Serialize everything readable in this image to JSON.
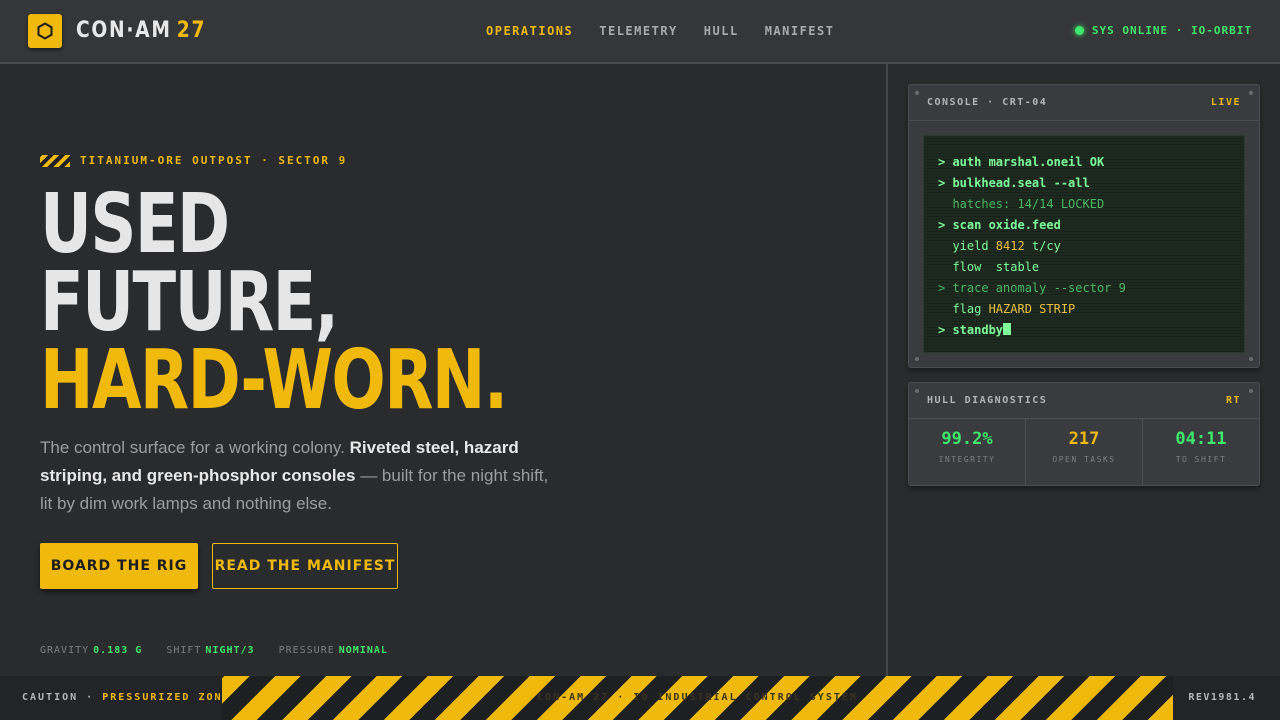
{
  "header": {
    "brand_name": "CON·AM",
    "brand_number": "27",
    "nav": [
      {
        "label": "OPERATIONS",
        "active": true
      },
      {
        "label": "TELEMETRY",
        "active": false
      },
      {
        "label": "HULL",
        "active": false
      },
      {
        "label": "MANIFEST",
        "active": false
      }
    ],
    "status": "SYS ONLINE · IO-ORBIT"
  },
  "hero": {
    "tag": "TITANIUM-ORE OUTPOST · SECTOR 9",
    "headline": [
      "USED",
      "FUTURE,",
      "HARD-WORN."
    ],
    "lede_plain_1": "The control surface for a working colony. ",
    "lede_bold": "Riveted steel, hazard striping, and green-phosphor consoles",
    "lede_plain_2": " — built for the night shift, lit by dim work lamps and nothing else.",
    "primary_button": "BOARD THE RIG",
    "secondary_button": "READ THE MANIFEST",
    "readouts": [
      {
        "label": "GRAVITY",
        "value": "0.183 G"
      },
      {
        "label": "SHIFT",
        "value": "NIGHT/3"
      },
      {
        "label": "PRESSURE",
        "value": "NOMINAL"
      }
    ]
  },
  "console": {
    "title": "CONSOLE · CRT-04",
    "badge": "LIVE",
    "lines": [
      {
        "text": "> auth marshal.oneil OK"
      },
      {
        "text": "> bulkhead.seal --all"
      },
      {
        "text": "  hatches: 14/14 LOCKED"
      },
      {
        "text": "> scan oxide.feed"
      },
      {
        "text": "  yield ",
        "accent": "8412",
        "rest": " t/cy"
      },
      {
        "text": "  flow  stable"
      },
      {
        "text": "> trace anomaly --sector 9"
      },
      {
        "text": "  flag ",
        "accent": "HAZARD STRIP"
      },
      {
        "text": "> standby"
      }
    ]
  },
  "diagnostics": {
    "title": "HULL DIAGNOSTICS",
    "badge": "RT",
    "stats": [
      {
        "value": "99.2%",
        "label": "INTEGRITY",
        "color": "#3ee86a"
      },
      {
        "value": "217",
        "label": "OPEN TASKS",
        "color": "#f0b90b"
      },
      {
        "value": "04:11",
        "label": "TO SHIFT",
        "color": "#3ee86a"
      }
    ]
  },
  "footer": {
    "caution_label": "CAUTION · ",
    "caution_value": "PRESSURIZED ZONE",
    "center_text": "CON-AM 27 · IO INDUSTRIAL CONTROL SYSTEM",
    "rev": "REV1981.4"
  },
  "colors": {
    "accent": "#f0b90b",
    "phosphor": "#3ee86a",
    "panel": "#3a3b3e",
    "background": "#2a2b2d"
  }
}
